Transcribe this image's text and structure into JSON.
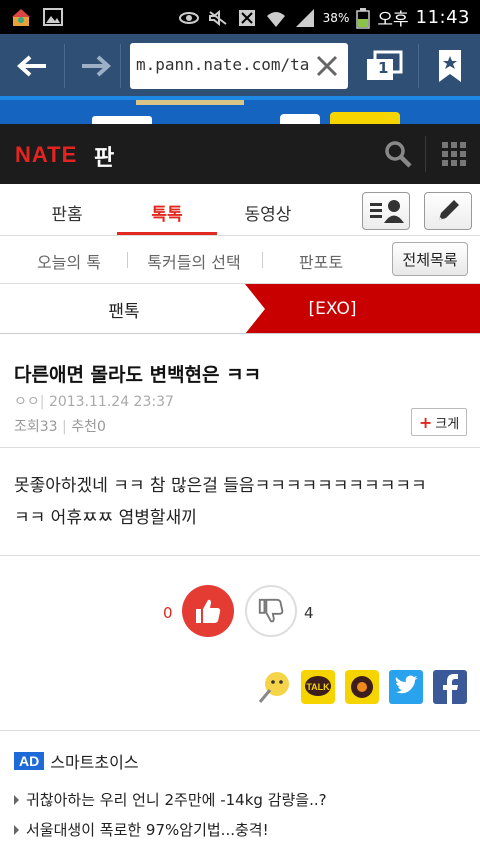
{
  "status_bar": {
    "battery_percent": "38%",
    "time": "11:43",
    "ampm": "오후",
    "icons": [
      "notification-icon",
      "gallery-icon",
      "eye-icon",
      "mute-icon",
      "screen-icon",
      "wifi-icon",
      "signal-icon",
      "battery-icon"
    ]
  },
  "browser": {
    "url": "m.pann.nate.com/talk",
    "tab_count": "1",
    "icons": [
      "back-arrow-icon",
      "forward-arrow-icon",
      "clear-icon",
      "tabs-icon",
      "bookmark-icon"
    ]
  },
  "header": {
    "logo": "NATE",
    "section": "판",
    "icons": [
      "search-icon",
      "menu-grid-icon"
    ]
  },
  "tabs": {
    "items": [
      {
        "label": "판홈"
      },
      {
        "label": "톡톡"
      },
      {
        "label": "동영상"
      }
    ],
    "active_index": 1,
    "icons": [
      "profile-list-icon",
      "pencil-icon"
    ]
  },
  "subnav": {
    "items": [
      {
        "label": "오늘의 톡"
      },
      {
        "label": "톡커들의 선택"
      },
      {
        "label": "판포토"
      }
    ],
    "all_list_label": "전체목록"
  },
  "category": {
    "left": "팬톡",
    "right": "[EXO]"
  },
  "article": {
    "title": "다른애면 몰라도 변백현은 ㅋㅋ",
    "author": "ㅇㅇ",
    "date": "2013.11.24 23:37",
    "views_label": "조회",
    "views": "33",
    "recommend_label": "추천",
    "recommend": "0",
    "zoom_label": "크게",
    "body_line1": "못좋아하겠네 ㅋㅋ 참 많은걸 들음ㅋㅋㅋㅋㅋㅋㅋㅋㅋㅋㅋ",
    "body_line2": "ㅋㅋ 어휴ㅉㅉ 염병할새끼"
  },
  "votes": {
    "up_count": "0",
    "down_count": "4"
  },
  "share": {
    "icons": [
      "emoticon-share-icon",
      "kakaotalk-icon",
      "kakaostory-icon",
      "twitter-icon",
      "facebook-icon"
    ],
    "colors": {
      "kakao": "#f5d400",
      "twitter": "#2aa3ef",
      "facebook": "#3b5998"
    }
  },
  "ad": {
    "badge": "AD",
    "title": "스마트초이스",
    "links": [
      "귀찮아하는 우리 언니 2주만에 -14kg 감량을..?",
      "서울대생이 폭로한 97%암기법...충격!"
    ]
  },
  "colors": {
    "accent": "#e0281f",
    "browser_bar": "#2f4f74",
    "header_bg": "#1c1c1c",
    "category_active": "#c90000"
  }
}
